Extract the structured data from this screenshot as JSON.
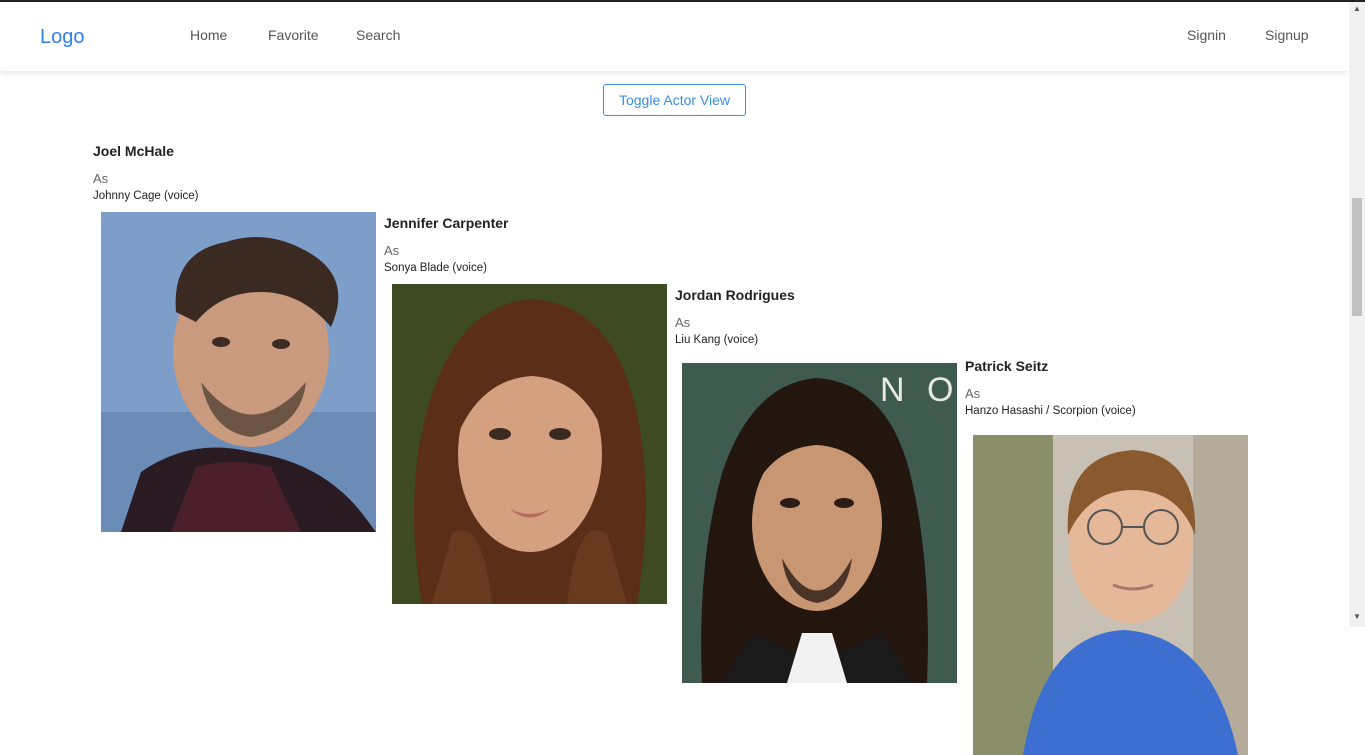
{
  "navbar": {
    "logo": "Logo",
    "left_links": [
      "Home",
      "Favorite",
      "Search"
    ],
    "right_links": [
      "Signin",
      "Signup"
    ]
  },
  "toggle_button": "Toggle Actor View",
  "actors": [
    {
      "name": "Joel McHale",
      "as": "As",
      "role": "Johnny Cage (voice)"
    },
    {
      "name": "Jennifer Carpenter",
      "as": "As",
      "role": "Sonya Blade (voice)"
    },
    {
      "name": "Jordan Rodrigues",
      "as": "As",
      "role": "Liu Kang (voice)"
    },
    {
      "name": "Patrick Seitz",
      "as": "As",
      "role": "Hanzo Hasashi / Scorpion (voice)"
    }
  ],
  "colors": {
    "accent": "#3a8ee6",
    "logo": "#2f80ed"
  },
  "scrollbar": {
    "up_icon": "▲",
    "down_icon": "▼"
  }
}
